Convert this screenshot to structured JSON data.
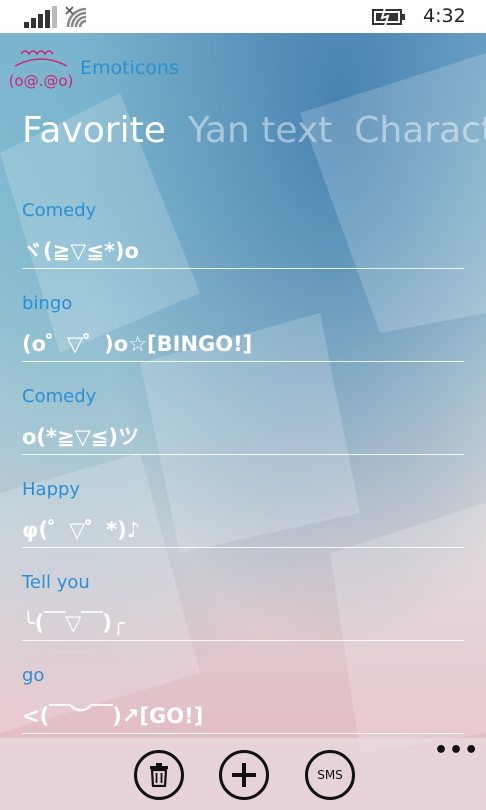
{
  "status_bar": {
    "time": "4:32",
    "signal_icon": "signal-bars-icon",
    "wifi_icon": "wifi-icon",
    "battery_icon": "battery-charging-icon"
  },
  "app": {
    "title": "Emoticons",
    "logo_text": "(o@.@o)",
    "logo_color": "#d0237a",
    "accent": "#2d8fd3"
  },
  "pivot": {
    "tabs": [
      {
        "label": "Favorite"
      },
      {
        "label": "Yan text"
      },
      {
        "label": "Characte"
      }
    ]
  },
  "favorites": [
    {
      "category": "Comedy",
      "emoticon": "ヾ(≧▽≦*)o"
    },
    {
      "category": "bingo",
      "emoticon": "(o゜▽゜)o☆[BINGO!]"
    },
    {
      "category": "Comedy",
      "emoticon": "o(*≧▽≦)ツ"
    },
    {
      "category": "Happy",
      "emoticon": "φ(゜▽゜*)♪"
    },
    {
      "category": "Tell you",
      "emoticon": "╰(￣▽￣)╭"
    },
    {
      "category": "go",
      "emoticon": "<(￣︶￣)↗[GO!]"
    }
  ],
  "app_bar": {
    "delete_icon": "trash-icon",
    "add_icon": "plus-icon",
    "sms_label": "SMS",
    "more_label": "•••"
  }
}
